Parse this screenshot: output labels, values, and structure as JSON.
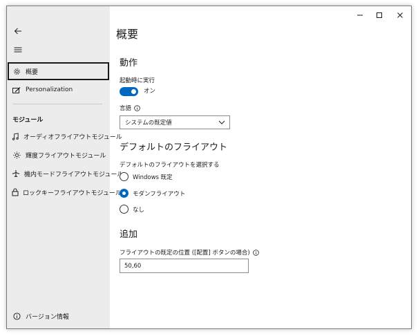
{
  "window": {
    "controls": [
      "minimize",
      "maximize",
      "close"
    ]
  },
  "sidebar": {
    "back_icon": "back-arrow-icon",
    "menu_icon": "hamburger-icon",
    "items": [
      {
        "label": "概要",
        "icon": "gear-icon",
        "selected": true
      },
      {
        "label": "Personalization",
        "icon": "personalization-icon",
        "selected": false
      }
    ],
    "module_section_label": "モジュール",
    "modules": [
      {
        "label": "オーディオフライアウトモジュール",
        "icon": "music-icon"
      },
      {
        "label": "輝度フライアウトモジュール",
        "icon": "brightness-icon"
      },
      {
        "label": "機内モードフライアウトモジュール",
        "icon": "airplane-icon"
      },
      {
        "label": "ロックキーフライアウトモジュール",
        "icon": "lock-icon"
      }
    ],
    "version_label": "バージョン情報",
    "version_icon": "info-icon"
  },
  "main": {
    "title": "概要",
    "behavior_heading": "動作",
    "startup_label": "起動時に実行",
    "startup_toggle_state": "オン",
    "language_label": "言語",
    "language_value": "システムの既定値",
    "flyout_heading": "デフォルトのフライアウト",
    "flyout_select_label": "デフォルトのフライアウトを選択する",
    "flyout_options": [
      {
        "label": "Windows 既定",
        "checked": false
      },
      {
        "label": "モダンフライアウト",
        "checked": true
      },
      {
        "label": "なし",
        "checked": false
      }
    ],
    "additional_heading": "追加",
    "position_label": "フライアウトの既定の位置 ([配置] ボタンの場合)",
    "position_value": "50,60"
  },
  "colors": {
    "accent": "#0067c0",
    "sidebar_bg": "#ececec"
  }
}
